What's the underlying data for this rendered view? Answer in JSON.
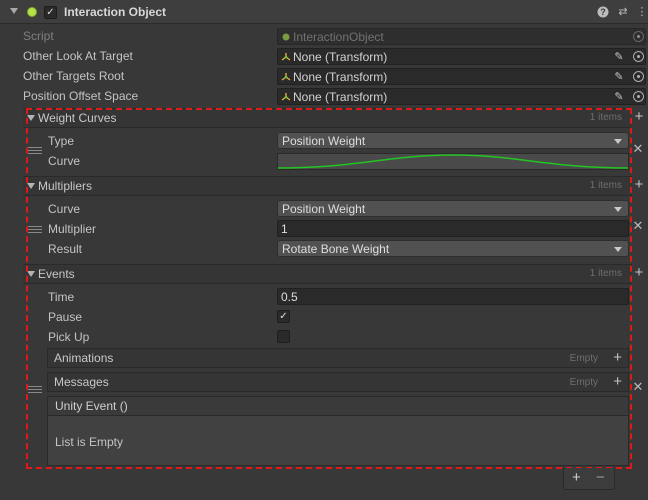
{
  "header": {
    "title": "Interaction Object",
    "enabled": true,
    "icons": [
      "help-icon",
      "preset-icon",
      "more-icon"
    ],
    "help_glyph": "?",
    "preset_glyph": "⇄",
    "more_glyph": "⋮",
    "check_glyph": "✓"
  },
  "fields": {
    "script": {
      "label": "Script",
      "value": "InteractionObject"
    },
    "other_look_at_target": {
      "label": "Other Look At Target",
      "value": "None (Transform)"
    },
    "other_targets_root": {
      "label": "Other Targets Root",
      "value": "None (Transform)"
    },
    "position_offset_space": {
      "label": "Position Offset Space",
      "value": "None (Transform)"
    }
  },
  "weight_curves": {
    "title": "Weight Curves",
    "count": "1 items",
    "type_label": "Type",
    "type_value": "Position Weight",
    "curve_label": "Curve"
  },
  "multipliers": {
    "title": "Multipliers",
    "count": "1 items",
    "curve_label": "Curve",
    "curve_value": "Position Weight",
    "multiplier_label": "Multiplier",
    "multiplier_value": "1",
    "result_label": "Result",
    "result_value": "Rotate Bone Weight"
  },
  "events": {
    "title": "Events",
    "count": "1 items",
    "time_label": "Time",
    "time_value": "0.5",
    "pause_label": "Pause",
    "pause_checked": true,
    "pickup_label": "Pick Up",
    "pickup_checked": false,
    "animations_label": "Animations",
    "animations_empty": "Empty",
    "messages_label": "Messages",
    "messages_empty": "Empty",
    "unity_event_title": "Unity Event ()",
    "unity_event_empty": "List is Empty"
  },
  "glyphs": {
    "plus": "+",
    "minus": "−",
    "remove": "✕",
    "pencil": "✎"
  },
  "colors": {
    "highlight_border": "#e01818",
    "curve": "#22c522",
    "script_dot": "#b6e04a"
  }
}
